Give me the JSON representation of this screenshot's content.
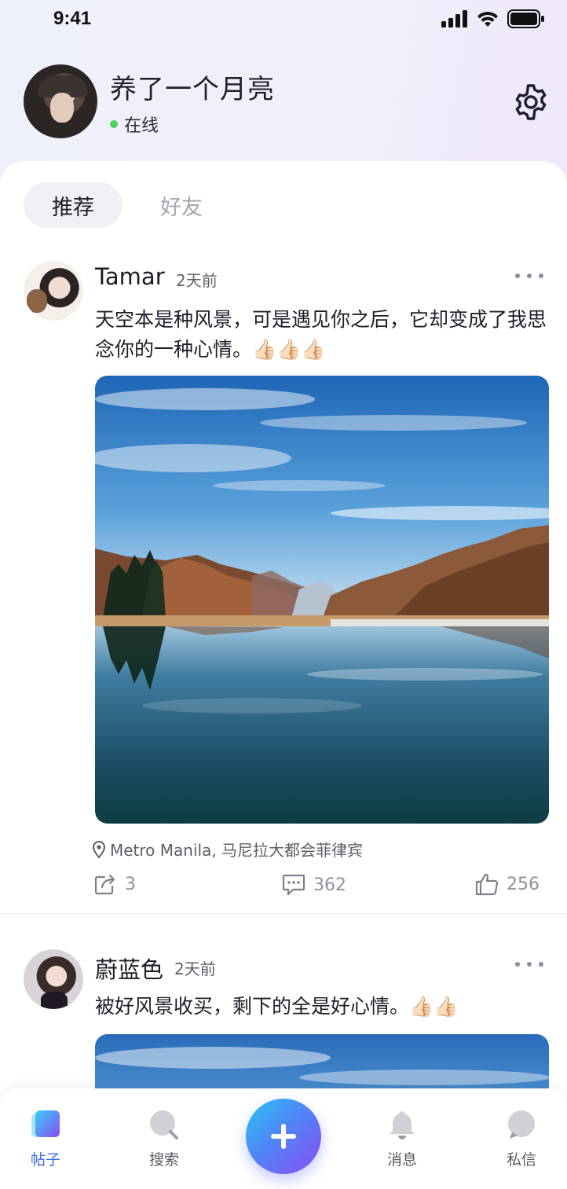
{
  "status_bar": {
    "time": "9:41"
  },
  "profile": {
    "name": "养了一个月亮",
    "status": "在线"
  },
  "tabs": [
    {
      "label": "推荐",
      "active": true
    },
    {
      "label": "好友",
      "active": false
    }
  ],
  "posts": [
    {
      "author": "Tamar",
      "time": "2天前",
      "text": "天空本是种风景，可是遇见你之后，它却变成了我思念你的一种心情。👍🏻👍🏻👍🏻",
      "location": "Metro Manila, 马尼拉大都会菲律宾",
      "shares": "3",
      "comments": "362",
      "likes": "256"
    },
    {
      "author": "蔚蓝色",
      "time": "2天前",
      "text": "被好风景收买，剩下的全是好心情。👍🏻👍🏻"
    }
  ],
  "bottom_nav": [
    {
      "label": "帖子",
      "icon": "posts-icon",
      "active": true
    },
    {
      "label": "搜索",
      "icon": "search-icon",
      "active": false
    },
    {
      "label": "",
      "icon": "plus-icon",
      "active": false
    },
    {
      "label": "消息",
      "icon": "bell-icon",
      "active": false
    },
    {
      "label": "私信",
      "icon": "chat-icon",
      "active": false
    }
  ],
  "colors": {
    "accent": "#3a6df0",
    "online": "#4cd15c",
    "fab_start": "#27c6f4",
    "fab_end": "#8b4cf5"
  }
}
